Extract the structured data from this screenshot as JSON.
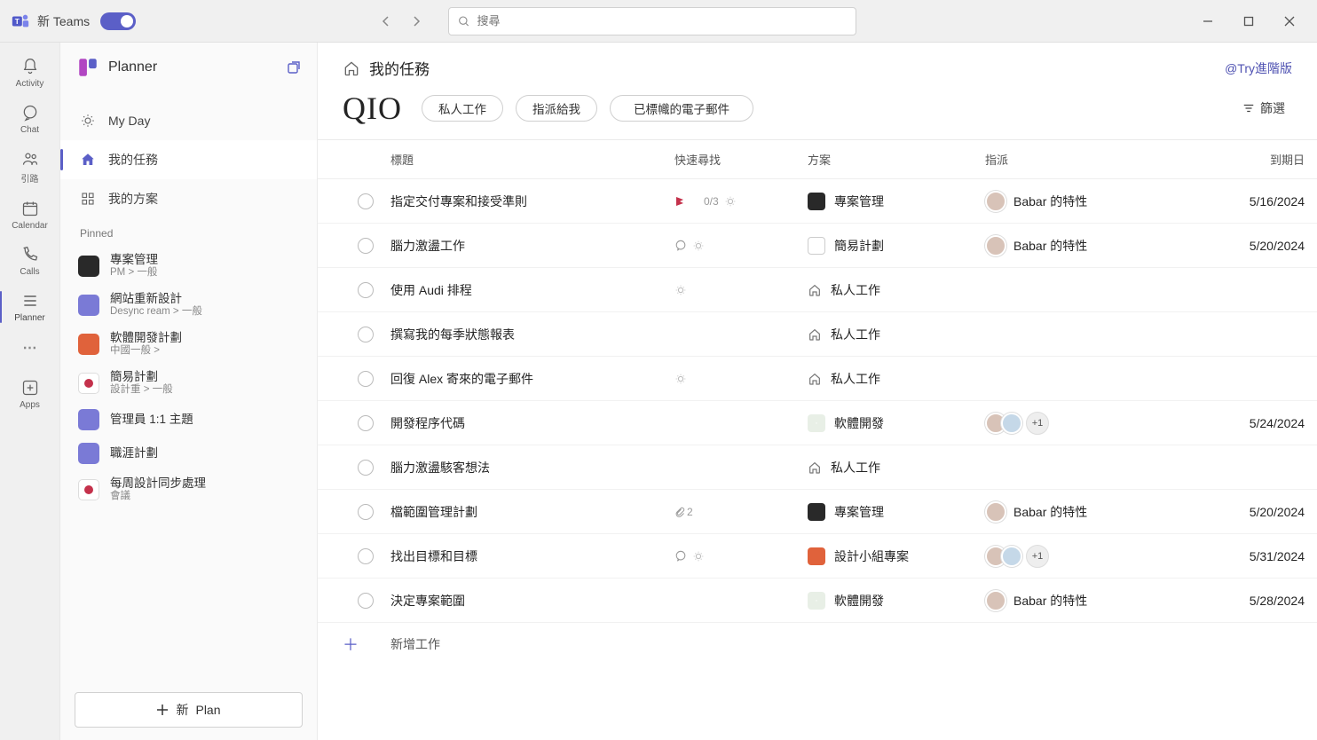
{
  "titlebar": {
    "new_teams_label": "新 Teams",
    "search_placeholder": "搜尋"
  },
  "rail": {
    "items": [
      {
        "label": "Activity"
      },
      {
        "label": "Chat"
      },
      {
        "label": "引路"
      },
      {
        "label": "Calendar"
      },
      {
        "label": "Calls"
      },
      {
        "label": "Planner"
      },
      {
        "label": "Apps"
      }
    ]
  },
  "plside": {
    "title": "Planner",
    "my_day": "My Day",
    "my_tasks": "我的任務",
    "my_plans": "我的方案",
    "pinned_label": "Pinned",
    "pinned": [
      {
        "title": "專案管理",
        "sub": "PM &gt; 一般",
        "color": "#292929"
      },
      {
        "title": "網站重新設計",
        "sub": "Desync ream > 一般",
        "color": "#7a7ad6"
      },
      {
        "title": "軟體開發計劃",
        "sub": "中國一般 &gt;",
        "color": "#e0623b"
      },
      {
        "title": "簡易計劃",
        "sub": "設計重 &gt; 一般",
        "color": "#ffffff"
      },
      {
        "title": "管理員 1:1 主題",
        "sub": "",
        "color": "#7a7ad6"
      },
      {
        "title": "職涯計劃",
        "sub": "",
        "color": "#7a7ad6"
      },
      {
        "title": "每周設計同步處理",
        "sub": "會議",
        "color": "#ffffff"
      }
    ],
    "new_plan_prefix": "新",
    "new_plan_label": "Plan"
  },
  "content": {
    "header_title": "我的任務",
    "try_premium": "@Try進階版",
    "qio": "QIO",
    "tabs": {
      "private": "私人工作",
      "assigned": "指派給我",
      "flagged": "已標幟的電子郵件"
    },
    "filter": "篩選",
    "columns": {
      "title": "標題",
      "quick": "快速尋找",
      "plan": "方案",
      "assign": "指派",
      "due": "到期日"
    },
    "add_task_label": "新增工作",
    "tasks": [
      {
        "title": "指定交付專案和接受準則",
        "quick": {
          "flag": true,
          "progress": "0/3",
          "light": true
        },
        "plan": {
          "name": "專案管理",
          "icon_bg": "#292929"
        },
        "assignees": [
          "Babar 的特性"
        ],
        "due": "5/16/2024"
      },
      {
        "title": "腦力激盪工作",
        "quick": {
          "chat": true,
          "light": true
        },
        "plan": {
          "name": "簡易計劃",
          "icon_bg": "#fff",
          "icon_border": true
        },
        "assignees": [
          "Babar 的特性"
        ],
        "due": "5/20/2024"
      },
      {
        "title": "使用 Audi 排程",
        "quick": {
          "light": true
        },
        "plan": {
          "name": "私人工作",
          "private": true
        },
        "assignees": [],
        "due": ""
      },
      {
        "title": "撰寫我的每季狀態報表",
        "quick": {},
        "plan": {
          "name": "私人工作",
          "private": true
        },
        "assignees": [],
        "due": ""
      },
      {
        "title": "回復 Alex 寄來的電子郵件",
        "quick": {
          "light": true
        },
        "plan": {
          "name": "私人工作",
          "private": true
        },
        "assignees": [],
        "due": ""
      },
      {
        "title": "開發程序代碼",
        "quick": {},
        "plan": {
          "name": "軟體開發",
          "icon_bg": "#e8efe6",
          "icon_text": "·"
        },
        "assignees": [
          "a",
          "b"
        ],
        "more": "+1",
        "due": "5/24/2024"
      },
      {
        "title": "腦力激盪駭客想法",
        "quick": {},
        "plan": {
          "name": "私人工作",
          "private": true
        },
        "assignees": [],
        "due": ""
      },
      {
        "title": "檔範圍管理計劃",
        "quick": {
          "attach": "2"
        },
        "plan": {
          "name": "專案管理",
          "icon_bg": "#292929"
        },
        "assignees": [
          "Babar 的特性"
        ],
        "due": "5/20/2024"
      },
      {
        "title": "找出目標和目標",
        "quick": {
          "chat": true,
          "light": true
        },
        "plan": {
          "name": "設計小組專案",
          "icon_bg": "#e0623b"
        },
        "assignees": [
          "a",
          "b"
        ],
        "more": "+1",
        "due": "5/31/2024"
      },
      {
        "title": "決定專案範圍",
        "quick": {},
        "plan": {
          "name": "軟體開發",
          "icon_bg": "#e8efe6",
          "icon_text": "·"
        },
        "assignees": [
          "Babar 的特性"
        ],
        "due": "5/28/2024"
      }
    ]
  }
}
